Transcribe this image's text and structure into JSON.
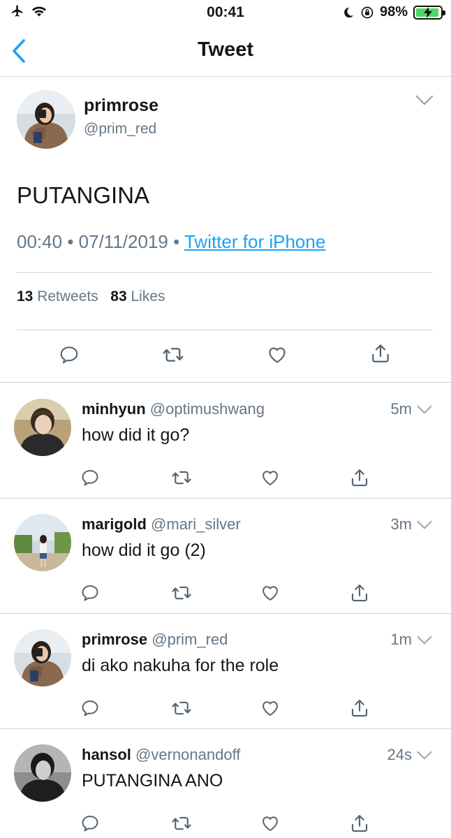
{
  "status_bar": {
    "time": "00:41",
    "battery": "98%"
  },
  "nav": {
    "title": "Tweet"
  },
  "main_tweet": {
    "name": "primrose",
    "handle": "@prim_red",
    "text": "PUTANGINA",
    "time": "00:40",
    "separator": "•",
    "date": "07/11/2019",
    "source": "Twitter for iPhone",
    "retweets_count": "13",
    "retweets_label": "Retweets",
    "likes_count": "83",
    "likes_label": "Likes"
  },
  "replies": [
    {
      "name": "minhyun",
      "handle": "@optimushwang",
      "time": "5m",
      "text": "how did it go?"
    },
    {
      "name": "marigold",
      "handle": "@mari_silver",
      "time": "3m",
      "text": "how did it go (2)"
    },
    {
      "name": "primrose",
      "handle": "@prim_red",
      "time": "1m",
      "text": "di ako nakuha for the role"
    },
    {
      "name": "hansol",
      "handle": "@vernonandoff",
      "time": "24s",
      "text": "PUTANGINA ANO"
    }
  ],
  "icons": {
    "reply": "speech-bubble-icon",
    "retweet": "retweet-icon",
    "like": "heart-icon",
    "share": "share-icon"
  },
  "colors": {
    "accent": "#1da1f2",
    "secondary_text": "#657786",
    "battery_fill": "#4cd964"
  }
}
